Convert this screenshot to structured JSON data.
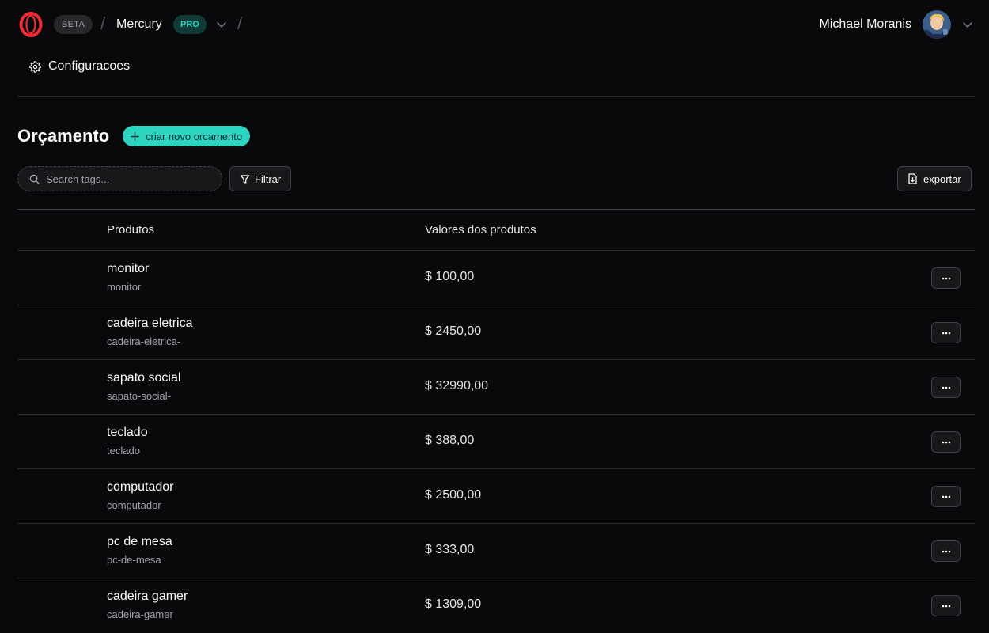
{
  "header": {
    "beta_label": "BETA",
    "workspace_name": "Mercury",
    "plan_label": "PRO",
    "user_name": "Michael Moranis"
  },
  "nav": {
    "settings_label": "Configuracoes"
  },
  "page": {
    "title": "Orçamento",
    "create_button": "criar novo orcamento"
  },
  "toolbar": {
    "search_placeholder": "Search tags...",
    "filter_label": "Filtrar",
    "export_label": "exportar"
  },
  "table": {
    "columns": [
      "Produtos",
      "Valores dos produtos"
    ],
    "rows": [
      {
        "name": "monitor",
        "slug": "monitor",
        "price": "$ 100,00"
      },
      {
        "name": "cadeira eletrica",
        "slug": "cadeira-eletrica-",
        "price": "$ 2450,00"
      },
      {
        "name": "sapato social",
        "slug": "sapato-social-",
        "price": "$ 32990,00"
      },
      {
        "name": "teclado",
        "slug": "teclado",
        "price": "$ 388,00"
      },
      {
        "name": "computador",
        "slug": "computador",
        "price": "$ 2500,00"
      },
      {
        "name": "pc de mesa",
        "slug": "pc-de-mesa",
        "price": "$ 333,00"
      },
      {
        "name": "cadeira gamer",
        "slug": "cadeira-gamer",
        "price": "$ 1309,00"
      }
    ]
  },
  "colors": {
    "background": "#09090b",
    "accent": "#2dd4bf",
    "logo_red": "#ef2b36",
    "border": "#27272a"
  },
  "icons": {
    "logo": "opera-o-logo",
    "dropdown": "chevron-down-icon",
    "settings": "gear-icon",
    "create": "plus-icon",
    "search": "search-icon",
    "filter": "filter-icon",
    "export": "file-export-icon",
    "row_menu": "more-horizontal-icon"
  }
}
